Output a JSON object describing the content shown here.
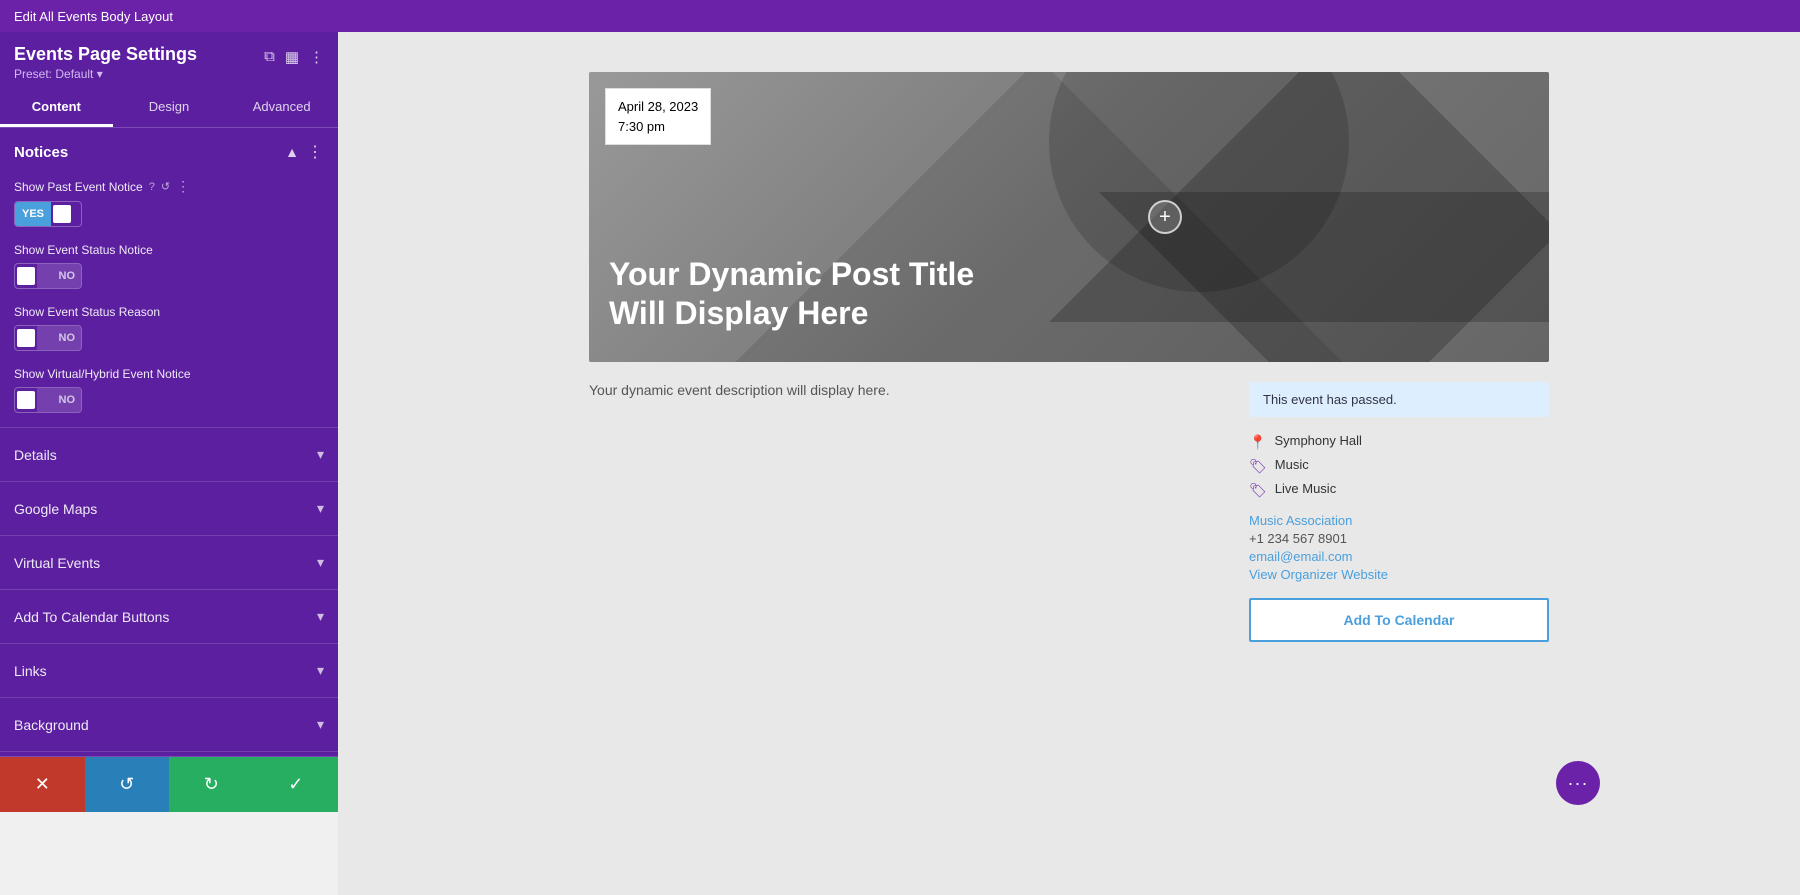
{
  "topBar": {
    "title": "Edit All Events Body Layout"
  },
  "sidebar": {
    "title": "Events Page Settings",
    "preset": "Preset: Default ▾",
    "tabs": [
      {
        "label": "Content",
        "active": true
      },
      {
        "label": "Design",
        "active": false
      },
      {
        "label": "Advanced",
        "active": false
      }
    ],
    "sections": {
      "notices": {
        "title": "Notices",
        "fields": [
          {
            "label": "Show Past Event Notice",
            "toggle": "yes"
          },
          {
            "label": "Show Event Status Notice",
            "toggle": "no"
          },
          {
            "label": "Show Event Status Reason",
            "toggle": "no"
          },
          {
            "label": "Show Virtual/Hybrid Event Notice",
            "toggle": "no"
          }
        ]
      },
      "collapsible": [
        {
          "label": "Details"
        },
        {
          "label": "Google Maps"
        },
        {
          "label": "Virtual Events"
        },
        {
          "label": "Add To Calendar Buttons"
        },
        {
          "label": "Links"
        },
        {
          "label": "Background"
        }
      ]
    },
    "bottomBar": {
      "cancel": "✕",
      "undo": "↺",
      "redo": "↻",
      "save": "✓"
    }
  },
  "canvas": {
    "dateBadge": {
      "date": "April 28, 2023",
      "time": "7:30 pm"
    },
    "heroTitle": "Your Dynamic Post Title Will Display Here",
    "addButtonLabel": "+",
    "description": "Your dynamic event description will display here.",
    "pastNotice": "This event has passed.",
    "meta": {
      "venue": "Symphony Hall",
      "category1": "Music",
      "category2": "Live Music"
    },
    "organizer": {
      "name": "Music Association",
      "phone": "+1 234 567 8901",
      "email": "email@email.com",
      "website": "View Organizer Website"
    },
    "addToCalendar": "Add To Calendar"
  },
  "floatingDots": "···"
}
